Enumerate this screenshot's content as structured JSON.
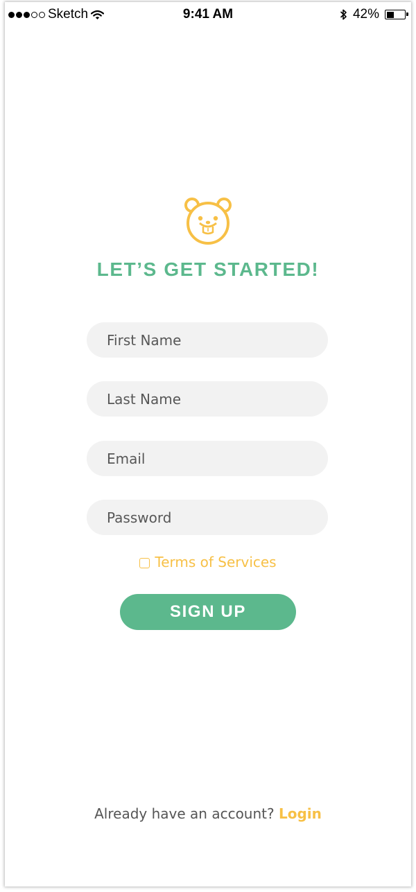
{
  "status_bar": {
    "carrier": "Sketch",
    "time": "9:41 AM",
    "battery_percent": "42%",
    "battery_level": 0.42,
    "signal_bars_filled": 3,
    "signal_bars_total": 5,
    "icons": [
      "wifi-icon",
      "bluetooth-icon",
      "battery-icon"
    ]
  },
  "logo": {
    "icon": "bear-face-icon",
    "color": "#f7c046"
  },
  "headline": "LET’S GET STARTED!",
  "form": {
    "first_name": {
      "placeholder": "First Name",
      "value": ""
    },
    "last_name": {
      "placeholder": "Last Name",
      "value": ""
    },
    "email": {
      "placeholder": "Email",
      "value": ""
    },
    "password": {
      "placeholder": "Password",
      "value": ""
    }
  },
  "terms": {
    "label": "Terms of Services",
    "checked": false
  },
  "signup_label": "SIGN UP",
  "footer": {
    "prompt": "Already have an account? ",
    "login_label": "Login"
  },
  "colors": {
    "accent_green": "#5cb88d",
    "accent_yellow": "#f7c046",
    "field_background": "#f2f2f2"
  }
}
